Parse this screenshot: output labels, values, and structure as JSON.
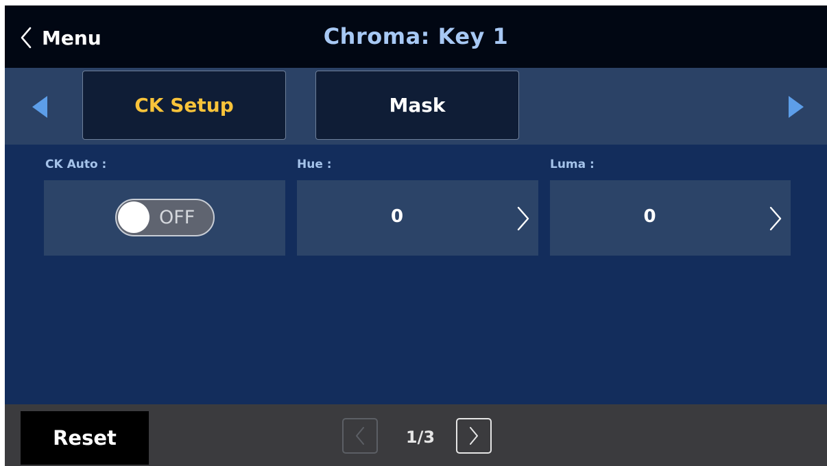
{
  "header": {
    "back_label": "Menu",
    "title": "Chroma: Key 1"
  },
  "tabs": [
    {
      "label": "CK Setup",
      "active": true
    },
    {
      "label": "Mask",
      "active": false
    }
  ],
  "params": {
    "ck_auto": {
      "label": "CK Auto :",
      "state": "OFF"
    },
    "hue": {
      "label": "Hue :",
      "value": "0"
    },
    "luma": {
      "label": "Luma :",
      "value": "0"
    }
  },
  "footer": {
    "reset_label": "Reset",
    "page_indicator": "1/3",
    "current_page": 1,
    "total_pages": 3
  },
  "icons": {
    "back": "chevron-left-icon",
    "tab_prev": "triangle-left-icon",
    "tab_next": "triangle-right-icon",
    "param_next": "chevron-right-icon"
  },
  "colors": {
    "header_bg": "#010713",
    "title": "#a7c8f4",
    "tabstrip_bg": "#2b4266",
    "active_tab_text": "#f8c33a",
    "content_bg": "#132d5c",
    "param_box_bg": "#2c4468",
    "footer_bg": "#3b3b3e",
    "arrow_blue": "#5d9ee9"
  }
}
